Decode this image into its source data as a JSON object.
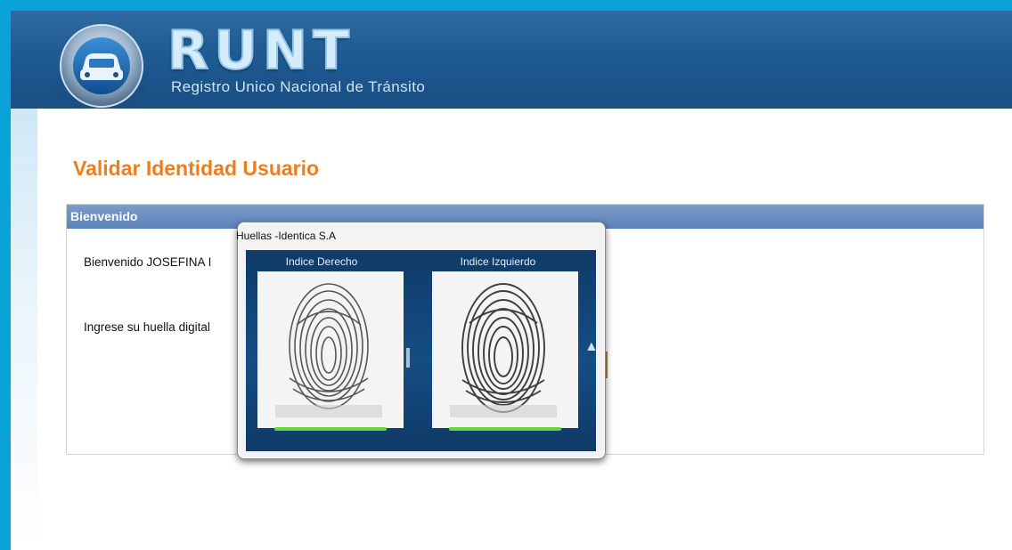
{
  "header": {
    "logo_text": "RUNT",
    "subtitle": "Registro Unico Nacional de Tránsito"
  },
  "page": {
    "title": "Validar Identidad Usuario"
  },
  "panel": {
    "title": "Bienvenido",
    "welcome_text": "Bienvenido JOSEFINA I",
    "instruction_text": "Ingrese su huella digital"
  },
  "dialog": {
    "title": "Huellas -Identica S.A",
    "fingers": [
      {
        "label": "Indice Derecho",
        "progress": 1.0
      },
      {
        "label": "Indice Izquierdo",
        "progress": 1.0
      }
    ]
  },
  "colors": {
    "accent_orange": "#ef7d1d",
    "header_blue": "#1f5a92",
    "panel_header": "#6e92c2",
    "progress_green": "#68d33b"
  },
  "icons": {
    "logo": "car-badge-icon",
    "fingerprint": "fingerprint-icon"
  }
}
